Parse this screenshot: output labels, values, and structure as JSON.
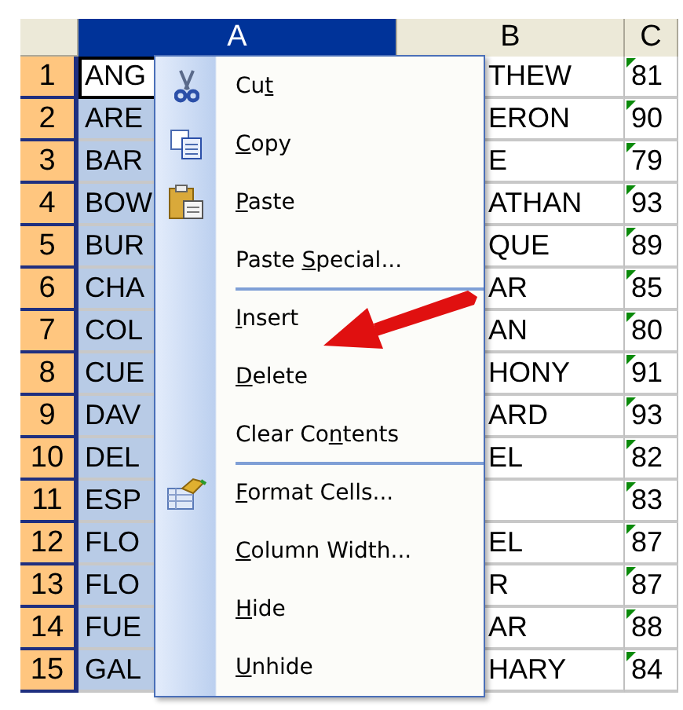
{
  "columns": [
    {
      "label": "A",
      "selected": true
    },
    {
      "label": "B",
      "selected": false
    },
    {
      "label": "C",
      "selected": false
    }
  ],
  "rows": [
    {
      "number": "1",
      "cells": [
        {
          "text": "ANG",
          "selected": false,
          "active": true
        },
        {
          "text": "THEW",
          "selected": false
        },
        {
          "text": "81",
          "selected": false,
          "error_flag": true
        }
      ]
    },
    {
      "number": "2",
      "cells": [
        {
          "text": "ARE",
          "selected": true
        },
        {
          "text": "ERON",
          "selected": false
        },
        {
          "text": "90",
          "selected": false,
          "error_flag": true
        }
      ]
    },
    {
      "number": "3",
      "cells": [
        {
          "text": "BAR",
          "selected": true
        },
        {
          "text": "E",
          "selected": false
        },
        {
          "text": "79",
          "selected": false,
          "error_flag": true
        }
      ]
    },
    {
      "number": "4",
      "cells": [
        {
          "text": "BOW",
          "selected": true
        },
        {
          "text": "ATHAN",
          "selected": false
        },
        {
          "text": "93",
          "selected": false,
          "error_flag": true
        }
      ]
    },
    {
      "number": "5",
      "cells": [
        {
          "text": "BUR",
          "selected": true
        },
        {
          "text": "QUE",
          "selected": false
        },
        {
          "text": "89",
          "selected": false,
          "error_flag": true
        }
      ]
    },
    {
      "number": "6",
      "cells": [
        {
          "text": "CHA",
          "selected": true
        },
        {
          "text": "AR",
          "selected": false
        },
        {
          "text": "85",
          "selected": false,
          "error_flag": true
        }
      ]
    },
    {
      "number": "7",
      "cells": [
        {
          "text": "COL",
          "selected": true
        },
        {
          "text": "AN",
          "selected": false
        },
        {
          "text": "80",
          "selected": false,
          "error_flag": true
        }
      ]
    },
    {
      "number": "8",
      "cells": [
        {
          "text": "CUE",
          "selected": true
        },
        {
          "text": "HONY",
          "selected": false
        },
        {
          "text": "91",
          "selected": false,
          "error_flag": true
        }
      ]
    },
    {
      "number": "9",
      "cells": [
        {
          "text": "DAV",
          "selected": true
        },
        {
          "text": "ARD",
          "selected": false
        },
        {
          "text": "93",
          "selected": false,
          "error_flag": true
        }
      ]
    },
    {
      "number": "10",
      "cells": [
        {
          "text": "DEL",
          "selected": true
        },
        {
          "text": "EL",
          "selected": false
        },
        {
          "text": "82",
          "selected": false,
          "error_flag": true
        }
      ]
    },
    {
      "number": "11",
      "cells": [
        {
          "text": "ESP",
          "selected": true
        },
        {
          "selected": false
        },
        {
          "text": "83",
          "selected": false,
          "error_flag": true
        }
      ]
    },
    {
      "number": "12",
      "cells": [
        {
          "text": "FLO",
          "selected": true
        },
        {
          "text": "EL",
          "selected": false
        },
        {
          "text": "87",
          "selected": false,
          "error_flag": true
        }
      ]
    },
    {
      "number": "13",
      "cells": [
        {
          "text": "FLO",
          "selected": true
        },
        {
          "text": "R",
          "selected": false
        },
        {
          "text": "87",
          "selected": false,
          "error_flag": true
        }
      ]
    },
    {
      "number": "14",
      "cells": [
        {
          "text": "FUE",
          "selected": true
        },
        {
          "text": "AR",
          "selected": false
        },
        {
          "text": "88",
          "selected": false,
          "error_flag": true
        }
      ]
    },
    {
      "number": "15",
      "cells": [
        {
          "text": "GAL",
          "selected": true
        },
        {
          "text": "HARY",
          "selected": false
        },
        {
          "text": "84",
          "selected": false,
          "error_flag": true
        }
      ]
    }
  ],
  "context_menu": [
    {
      "kind": "item",
      "label": {
        "pre": "Cu",
        "key": "t"
      }
    },
    {
      "kind": "item",
      "label": {
        "key": "C",
        "post": "opy"
      }
    },
    {
      "kind": "item",
      "label": {
        "key": "P",
        "post": "aste"
      }
    },
    {
      "kind": "item",
      "label": {
        "pre": "Paste ",
        "key": "S",
        "post": "pecial..."
      }
    },
    {
      "kind": "separator"
    },
    {
      "kind": "item",
      "label": {
        "key": "I",
        "post": "nsert"
      }
    },
    {
      "kind": "item",
      "label": {
        "key": "D",
        "post": "elete"
      }
    },
    {
      "kind": "item",
      "label": {
        "pre": "Clear Co",
        "key": "n",
        "post": "tents"
      }
    },
    {
      "kind": "separator"
    },
    {
      "kind": "item",
      "label": {
        "key": "F",
        "post": "ormat Cells..."
      }
    },
    {
      "kind": "item",
      "label": {
        "key": "C",
        "post": "olumn Width..."
      }
    },
    {
      "kind": "item",
      "label": {
        "key": "H",
        "post": "ide"
      }
    },
    {
      "kind": "item",
      "label": {
        "key": "U",
        "post": "nhide"
      }
    }
  ]
}
